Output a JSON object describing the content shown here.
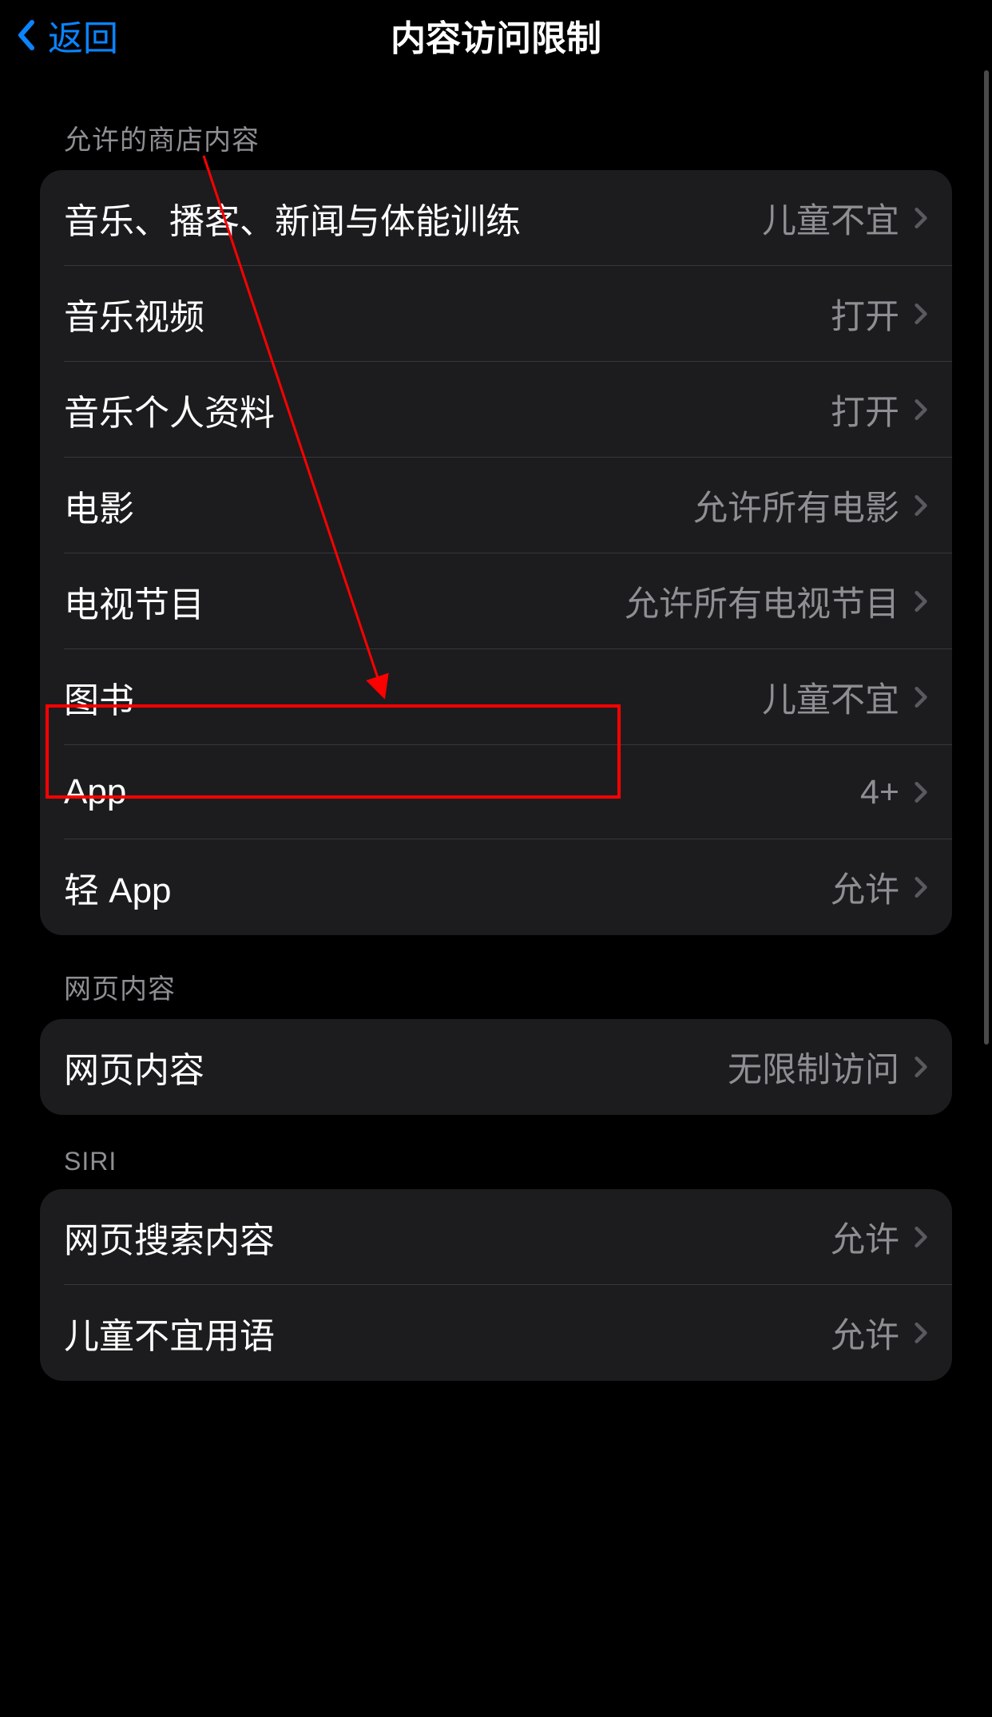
{
  "header": {
    "back_label": "返回",
    "title": "内容访问限制"
  },
  "sections": [
    {
      "header": "允许的商店内容",
      "items": [
        {
          "label": "音乐、播客、新闻与体能训练",
          "value": "儿童不宜"
        },
        {
          "label": "音乐视频",
          "value": "打开"
        },
        {
          "label": "音乐个人资料",
          "value": "打开"
        },
        {
          "label": "电影",
          "value": "允许所有电影"
        },
        {
          "label": "电视节目",
          "value": "允许所有电视节目"
        },
        {
          "label": "图书",
          "value": "儿童不宜"
        },
        {
          "label": "App",
          "value": "4+"
        },
        {
          "label": "轻 App",
          "value": "允许"
        }
      ]
    },
    {
      "header": "网页内容",
      "items": [
        {
          "label": "网页内容",
          "value": "无限制访问"
        }
      ]
    },
    {
      "header": "SIRI",
      "items": [
        {
          "label": "网页搜索内容",
          "value": "允许"
        },
        {
          "label": "儿童不宜用语",
          "value": "允许"
        }
      ]
    }
  ]
}
